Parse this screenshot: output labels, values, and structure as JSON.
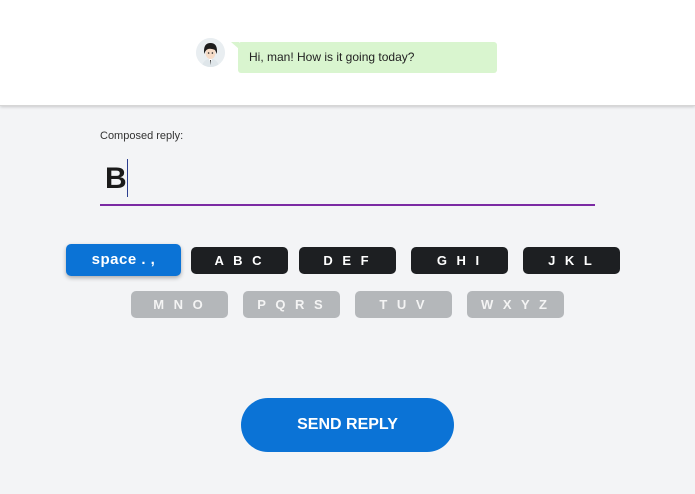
{
  "chat": {
    "avatar_icon": "user-avatar-icon",
    "incoming_message": "Hi, man! How is it going today?"
  },
  "composer": {
    "label": "Composed reply:",
    "text": "B",
    "underline_color": "#7b2aa3"
  },
  "keypad": {
    "row1": [
      {
        "label": "space . ,",
        "state": "active"
      },
      {
        "label": "A B C",
        "state": "enabled"
      },
      {
        "label": "D E F",
        "state": "enabled"
      },
      {
        "label": "G H I",
        "state": "enabled"
      },
      {
        "label": "J K L",
        "state": "enabled"
      }
    ],
    "row2": [
      {
        "label": "M N O",
        "state": "disabled"
      },
      {
        "label": "P Q R S",
        "state": "disabled"
      },
      {
        "label": "T U V",
        "state": "disabled"
      },
      {
        "label": "W X Y Z",
        "state": "disabled"
      }
    ]
  },
  "send": {
    "label": "SEND REPLY",
    "color": "#0b73d6"
  }
}
